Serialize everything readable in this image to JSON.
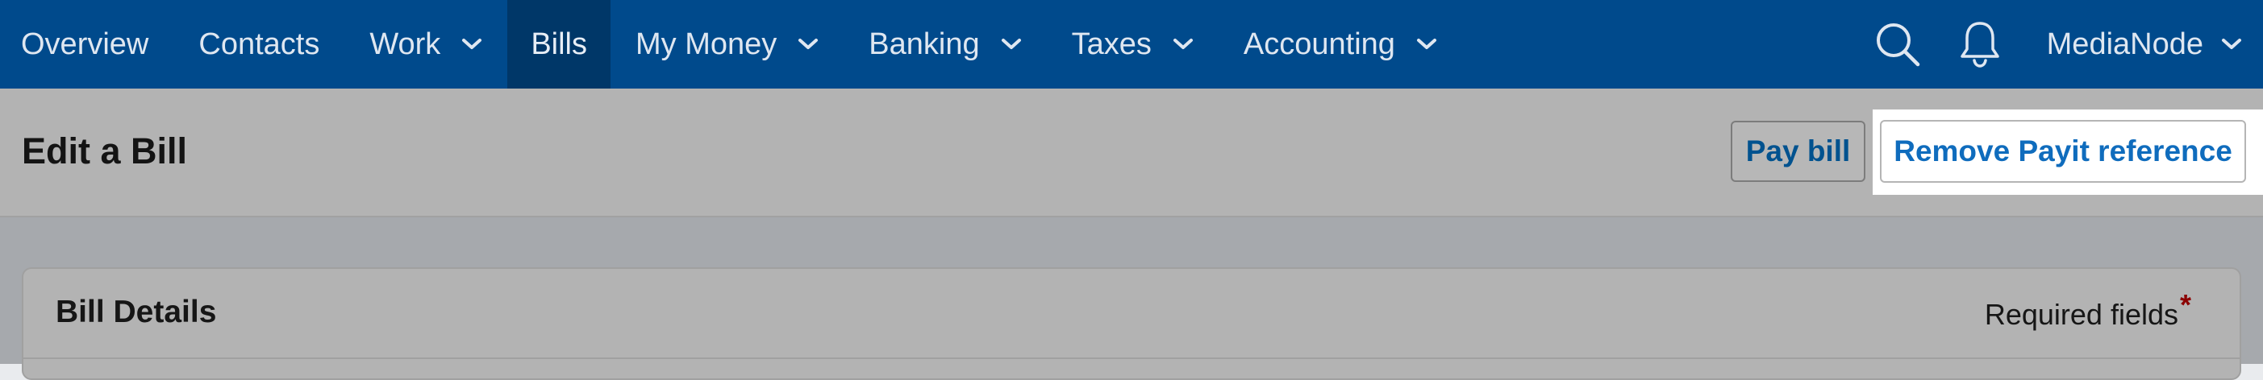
{
  "nav": {
    "items": [
      {
        "label": "Overview",
        "dropdown": false
      },
      {
        "label": "Contacts",
        "dropdown": false
      },
      {
        "label": "Work",
        "dropdown": true
      },
      {
        "label": "Bills",
        "dropdown": false,
        "active": true
      },
      {
        "label": "My Money",
        "dropdown": true
      },
      {
        "label": "Banking",
        "dropdown": true
      },
      {
        "label": "Taxes",
        "dropdown": true
      },
      {
        "label": "Accounting",
        "dropdown": true
      }
    ],
    "search_icon": "search-icon",
    "notifications_icon": "bell-icon",
    "org_name": "MediaNode"
  },
  "page": {
    "title": "Edit a Bill",
    "pay_bill_label": "Pay bill",
    "remove_reference_label": "Remove Payit reference"
  },
  "card": {
    "title": "Bill Details",
    "required_label": "Required fields",
    "required_marker": "*"
  },
  "colors": {
    "nav_background": "#004a8c",
    "nav_active": "#003768",
    "link_blue": "#0f6cbd",
    "required_star": "#8b0000"
  }
}
